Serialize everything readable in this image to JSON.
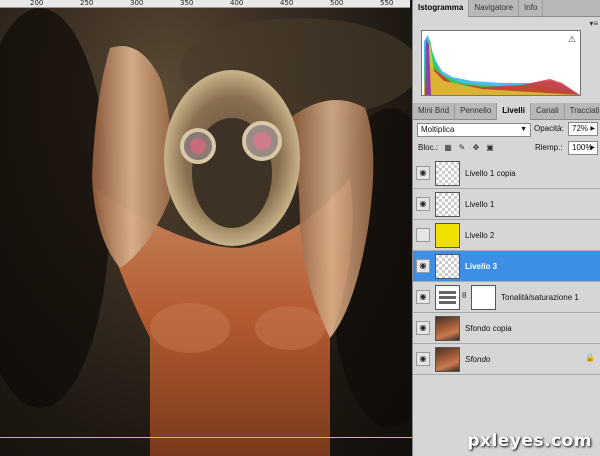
{
  "ruler": {
    "labels": [
      "200",
      "250",
      "300",
      "350",
      "400",
      "450",
      "500",
      "550"
    ]
  },
  "panel_top": {
    "tabs": [
      {
        "label": "Istogramma",
        "active": true
      },
      {
        "label": "Navigatore",
        "active": false
      },
      {
        "label": "Info",
        "active": false
      }
    ],
    "warning_icon": "warning-icon"
  },
  "panel_layers": {
    "tabs": [
      {
        "label": "Mini Brid",
        "active": false
      },
      {
        "label": "Pennello",
        "active": false
      },
      {
        "label": "Livelli",
        "active": true
      },
      {
        "label": "Canali",
        "active": false
      },
      {
        "label": "Tracciati",
        "active": false
      }
    ],
    "blend_mode": "Moltiplica",
    "opacity_label": "Opacità:",
    "opacity_value": "72%",
    "lock_label": "Bloc.:",
    "fill_label": "Riemp.:",
    "fill_value": "100%",
    "layers": [
      {
        "name": "Livello 1 copia",
        "visible": true,
        "thumb": "checker",
        "selected": false
      },
      {
        "name": "Livello 1",
        "visible": true,
        "thumb": "checker",
        "selected": false
      },
      {
        "name": "Livello 2",
        "visible": false,
        "thumb": "yellow",
        "selected": false
      },
      {
        "name": "Livello 3",
        "visible": true,
        "thumb": "checker",
        "selected": true
      },
      {
        "name": "Tonalità/saturazione 1",
        "visible": true,
        "thumb": "adj",
        "selected": false
      },
      {
        "name": "Sfondo copia",
        "visible": true,
        "thumb": "photo",
        "selected": false
      },
      {
        "name": "Sfondo",
        "visible": true,
        "thumb": "photo",
        "selected": false,
        "locked": true
      }
    ]
  },
  "watermark": "pxleyes.com",
  "colors": {
    "selected_layer": "#3d8ee6",
    "guide_line": "#d4c23a",
    "yellow_layer": "#f0e000"
  }
}
